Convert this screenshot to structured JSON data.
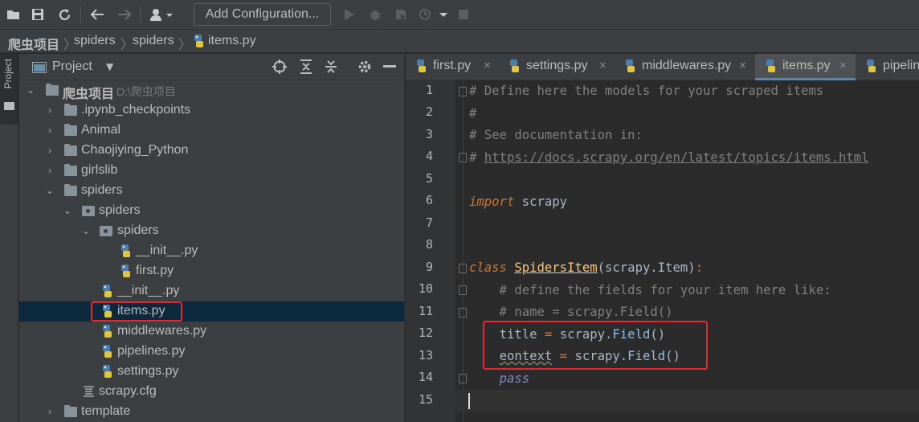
{
  "toolbar": {
    "add_configuration_label": "Add Configuration..."
  },
  "breadcrumb": [
    "爬虫项目",
    "spiders",
    "spiders",
    "items.py"
  ],
  "left_stripe": {
    "label": "Project"
  },
  "project_panel": {
    "title": "Project",
    "tree": [
      {
        "label": "爬虫项目",
        "hint": "D:\\爬虫项目",
        "kind": "folder",
        "expanded": true
      },
      {
        "label": ".ipynb_checkpoints",
        "kind": "folder",
        "expanded": false
      },
      {
        "label": "Animal",
        "kind": "folder",
        "expanded": false
      },
      {
        "label": "Chaojiying_Python",
        "kind": "folder",
        "expanded": false
      },
      {
        "label": "girlslib",
        "kind": "folder",
        "expanded": false
      },
      {
        "label": "spiders",
        "kind": "folder",
        "expanded": true
      },
      {
        "label": "spiders",
        "kind": "package",
        "expanded": true
      },
      {
        "label": "spiders",
        "kind": "package",
        "expanded": true
      },
      {
        "label": "__init__.py",
        "kind": "python"
      },
      {
        "label": "first.py",
        "kind": "python"
      },
      {
        "label": "__init__.py",
        "kind": "python"
      },
      {
        "label": "items.py",
        "kind": "python",
        "selected": true
      },
      {
        "label": "middlewares.py",
        "kind": "python"
      },
      {
        "label": "pipelines.py",
        "kind": "python"
      },
      {
        "label": "settings.py",
        "kind": "python"
      },
      {
        "label": "scrapy.cfg",
        "kind": "config"
      },
      {
        "label": "template",
        "kind": "folder",
        "expanded": false
      }
    ]
  },
  "editor": {
    "tabs": [
      {
        "label": "first.py",
        "active": false
      },
      {
        "label": "settings.py",
        "active": false
      },
      {
        "label": "middlewares.py",
        "active": false
      },
      {
        "label": "items.py",
        "active": true
      },
      {
        "label": "pipelines.py",
        "active": false
      }
    ],
    "line_numbers": [
      "1",
      "2",
      "3",
      "4",
      "5",
      "6",
      "7",
      "8",
      "9",
      "10",
      "11",
      "12",
      "13",
      "14",
      "15"
    ],
    "code": {
      "l1": "# Define here the models for your scraped items",
      "l2": "#",
      "l3": "# See documentation in:",
      "l4_hash": "# ",
      "l4_link": "https://docs.scrapy.org/en/latest/topics/items.html",
      "l6_kw": "import",
      "l6_rest": " scrapy",
      "l9_kw": "class",
      "l9_name": "SpidersItem",
      "l9_rest": "(scrapy.Item)",
      "l9_colon": ":",
      "l10": "    # define the fields for your item here like:",
      "l11": "    # name = scrapy.Field()",
      "l12_name": "title",
      "l12_eq": " = ",
      "l12_obj": "scrapy.",
      "l12_fn": "Field",
      "l12_paren": "()",
      "l13_name": "eontext",
      "l13_eq": " = ",
      "l13_obj": "scrapy.",
      "l13_fn": "Field",
      "l13_paren": "()",
      "l14_kw": "pass"
    }
  },
  "colors": {
    "highlight_box": "#e8262d",
    "selection": "#0d293e",
    "active_tab_underline": "#4a88c7"
  }
}
